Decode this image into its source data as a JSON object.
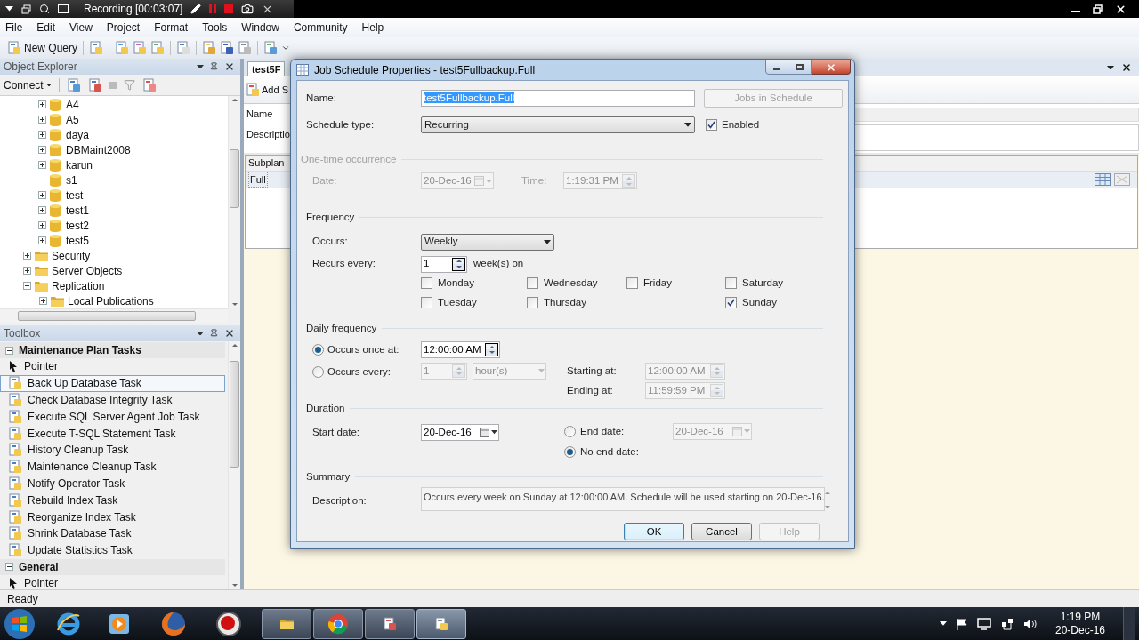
{
  "recorder_bar": {
    "title": "Recording [00:03:07]"
  },
  "menu": [
    "File",
    "Edit",
    "View",
    "Project",
    "Format",
    "Tools",
    "Window",
    "Community",
    "Help"
  ],
  "toolbar": {
    "new_query": "New Query"
  },
  "object_explorer": {
    "title": "Object Explorer",
    "connect": "Connect",
    "databases": [
      {
        "label": "A4",
        "expandable": true
      },
      {
        "label": "A5",
        "expandable": true
      },
      {
        "label": "daya",
        "expandable": true
      },
      {
        "label": "DBMaint2008",
        "expandable": true
      },
      {
        "label": "karun",
        "expandable": true
      },
      {
        "label": "s1",
        "expandable": false
      },
      {
        "label": "test",
        "expandable": true
      },
      {
        "label": "test1",
        "expandable": true
      },
      {
        "label": "test2",
        "expandable": true
      },
      {
        "label": "test5",
        "expandable": true
      }
    ],
    "folders": [
      {
        "label": "Security",
        "expanded": false
      },
      {
        "label": "Server Objects",
        "expanded": false
      },
      {
        "label": "Replication",
        "expanded": true,
        "children": [
          {
            "label": "Local Publications",
            "expanded": false
          }
        ]
      }
    ]
  },
  "toolbox": {
    "title": "Toolbox",
    "groups": [
      {
        "label": "Maintenance Plan Tasks",
        "expanded": true,
        "items": [
          {
            "label": "Pointer",
            "kind": "pointer",
            "selected": false
          },
          {
            "label": "Back Up Database Task",
            "kind": "task",
            "selected": true
          },
          {
            "label": "Check Database Integrity Task",
            "kind": "task",
            "selected": false
          },
          {
            "label": "Execute SQL Server Agent Job Task",
            "kind": "task",
            "selected": false
          },
          {
            "label": "Execute T-SQL Statement Task",
            "kind": "task",
            "selected": false
          },
          {
            "label": "History Cleanup Task",
            "kind": "task",
            "selected": false
          },
          {
            "label": "Maintenance Cleanup Task",
            "kind": "task",
            "selected": false
          },
          {
            "label": "Notify Operator Task",
            "kind": "task",
            "selected": false
          },
          {
            "label": "Rebuild Index Task",
            "kind": "task",
            "selected": false
          },
          {
            "label": "Reorganize Index Task",
            "kind": "task",
            "selected": false
          },
          {
            "label": "Shrink Database Task",
            "kind": "task",
            "selected": false
          },
          {
            "label": "Update Statistics Task",
            "kind": "task",
            "selected": false
          }
        ]
      },
      {
        "label": "General",
        "expanded": true,
        "items": [
          {
            "label": "Pointer",
            "kind": "pointer",
            "selected": false
          }
        ]
      }
    ]
  },
  "document": {
    "tab": "test5F",
    "add_button": "Add S",
    "name_label": "Name",
    "description_label": "Descriptio",
    "grid_header": "Subplan",
    "grid_row": "Full"
  },
  "dialog": {
    "title": "Job Schedule Properties - test5Fullbackup.Full",
    "name_label": "Name:",
    "name_value": "test5Fullbackup.Full",
    "jobs_button": {
      "label": "Jobs in Schedule",
      "disabled": true
    },
    "schedule_type_label": "Schedule type:",
    "schedule_type": "Recurring",
    "enabled": {
      "label": "Enabled",
      "checked": true
    },
    "one_time": {
      "title": "One-time occurrence",
      "disabled": true,
      "date_label": "Date:",
      "date": "20-Dec-16",
      "time_label": "Time:",
      "time": "1:19:31 PM"
    },
    "frequency": {
      "title": "Frequency",
      "occurs_label": "Occurs:",
      "occurs": "Weekly",
      "recurs_label": "Recurs every:",
      "recurs_value": "1",
      "recurs_unit": "week(s) on",
      "day_columns": [
        [
          {
            "label": "Monday",
            "checked": false
          },
          {
            "label": "Tuesday",
            "checked": false
          }
        ],
        [
          {
            "label": "Wednesday",
            "checked": false
          },
          {
            "label": "Thursday",
            "checked": false
          }
        ],
        [
          {
            "label": "Friday",
            "checked": false
          }
        ],
        [
          {
            "label": "Saturday",
            "checked": false
          },
          {
            "label": "Sunday",
            "checked": true
          }
        ]
      ]
    },
    "daily": {
      "title": "Daily frequency",
      "options": [
        {
          "label": "Occurs once at:",
          "selected": true
        },
        {
          "label": "Occurs every:",
          "selected": false
        }
      ],
      "once_time": "12:00:00 AM",
      "every_value": "1",
      "every_unit": "hour(s)",
      "starting_label": "Starting at:",
      "starting": "12:00:00 AM",
      "ending_label": "Ending at:",
      "ending": "11:59:59 PM"
    },
    "duration": {
      "title": "Duration",
      "start_label": "Start date:",
      "start": "20-Dec-16",
      "end_options": [
        {
          "label": "End date:",
          "selected": false
        },
        {
          "label": "No end date:",
          "selected": true
        }
      ],
      "end_date": "20-Dec-16"
    },
    "summary": {
      "title": "Summary",
      "description_label": "Description:",
      "description": "Occurs every week on Sunday at 12:00:00 AM. Schedule will be used starting on 20-Dec-16."
    },
    "buttons": [
      {
        "label": "OK",
        "disabled": false,
        "default": true
      },
      {
        "label": "Cancel",
        "disabled": false,
        "default": false
      },
      {
        "label": "Help",
        "disabled": true,
        "default": false
      }
    ]
  },
  "status_bar": "Ready",
  "clock": {
    "time": "1:19 PM",
    "date": "20-Dec-16"
  }
}
